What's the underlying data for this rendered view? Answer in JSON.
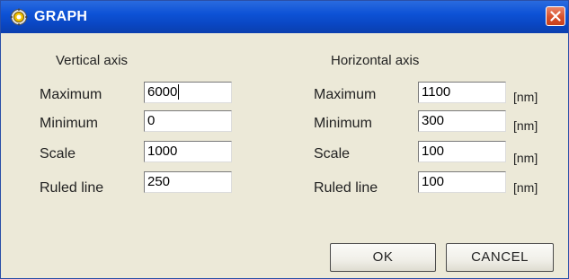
{
  "window": {
    "title": "GRAPH",
    "icon": "graph-app-icon",
    "close_icon": "close-icon"
  },
  "vertical": {
    "heading": "Vertical axis",
    "fields": [
      {
        "label": "Maximum",
        "value": "6000"
      },
      {
        "label": "Minimum",
        "value": "0"
      },
      {
        "label": "Scale",
        "value": "1000"
      },
      {
        "label": "Ruled line",
        "value": "250"
      }
    ]
  },
  "horizontal": {
    "heading": "Horizontal axis",
    "unit": "[nm]",
    "fields": [
      {
        "label": "Maximum",
        "value": "1100",
        "unit": "[nm]"
      },
      {
        "label": "Minimum",
        "value": "300",
        "unit": "[nm]"
      },
      {
        "label": "Scale",
        "value": "100",
        "unit": "[nm]"
      },
      {
        "label": "Ruled line",
        "value": "100",
        "unit": "[nm]"
      }
    ]
  },
  "buttons": {
    "ok": "OK",
    "cancel": "CANCEL"
  },
  "colors": {
    "titlebar": "#0d52d6",
    "dialog_bg": "#ece9d8",
    "close_button": "#d8512c"
  }
}
